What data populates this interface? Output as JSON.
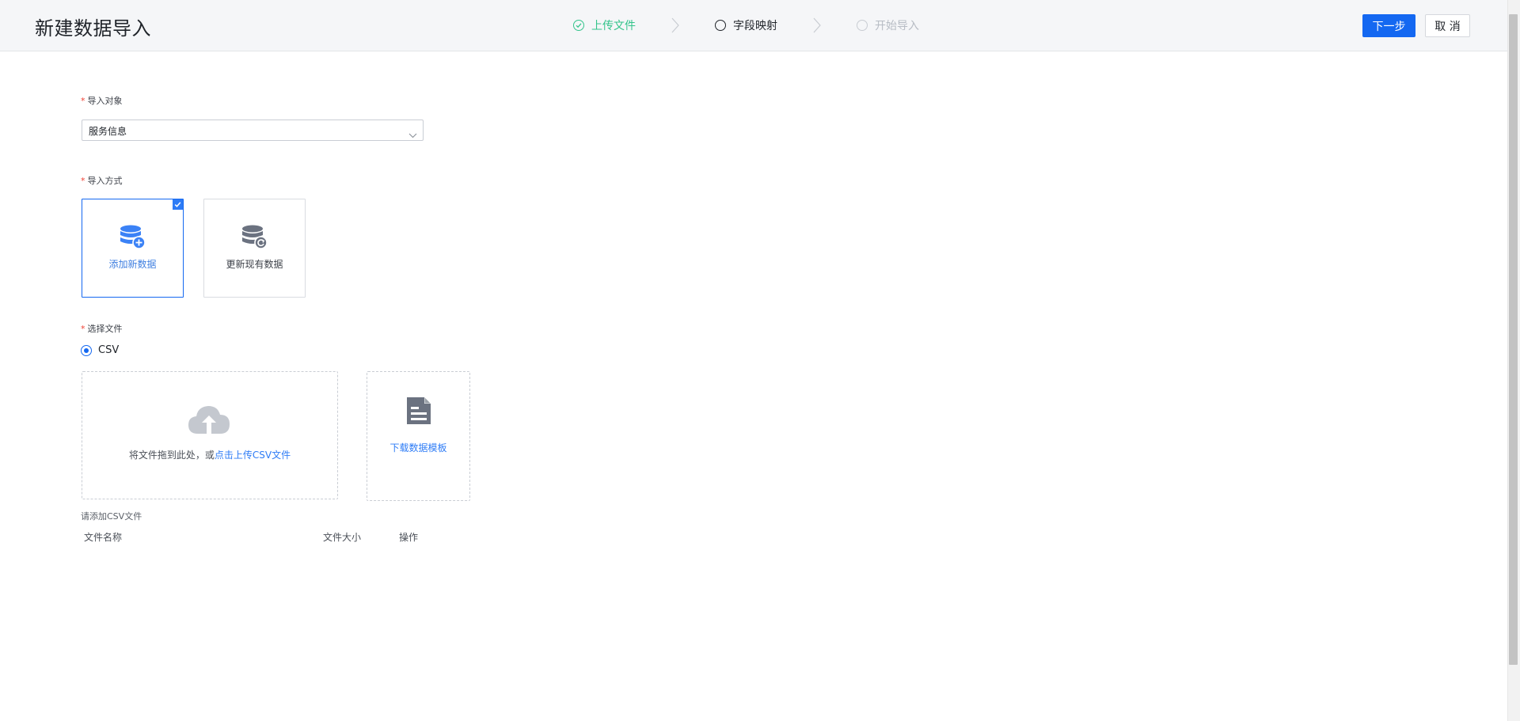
{
  "header": {
    "title": "新建数据导入",
    "steps": [
      {
        "label": "上传文件",
        "state": "done"
      },
      {
        "label": "字段映射",
        "state": "active"
      },
      {
        "label": "开始导入",
        "state": "pending"
      }
    ],
    "next_label": "下一步",
    "cancel_label": "取 消"
  },
  "form": {
    "import_target": {
      "label": "导入对象",
      "value": "服务信息"
    },
    "import_method": {
      "label": "导入方式",
      "options": [
        {
          "label": "添加新数据",
          "icon": "database-add-icon",
          "selected": true
        },
        {
          "label": "更新现有数据",
          "icon": "database-refresh-icon",
          "selected": false
        }
      ]
    },
    "file": {
      "label": "选择文件",
      "type_option": "CSV",
      "dropzone_text": "将文件拖到此处，或",
      "dropzone_link": "点击上传CSV文件",
      "template_label": "下载数据模板",
      "hint": "请添加CSV文件",
      "columns": [
        "文件名称",
        "文件大小",
        "操作"
      ]
    }
  },
  "colors": {
    "primary": "#1468f1",
    "success": "#34c48b",
    "required": "#f04134"
  }
}
